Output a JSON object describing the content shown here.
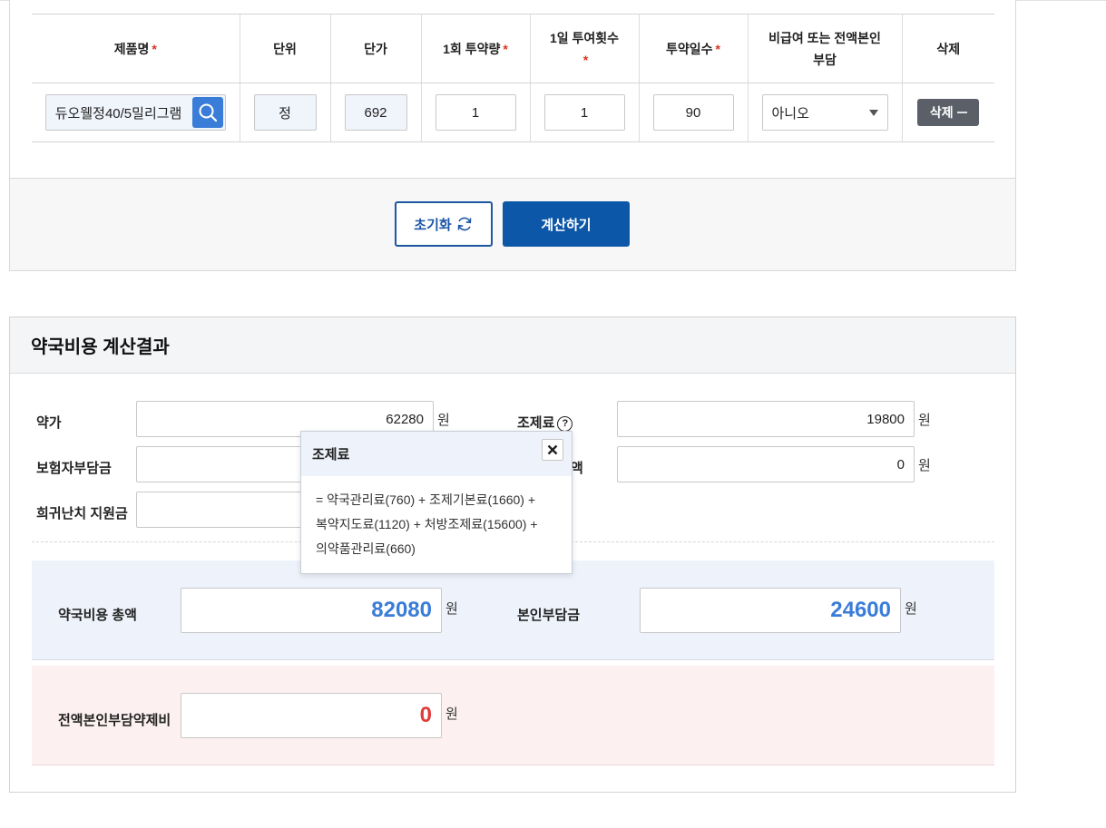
{
  "table": {
    "headers": {
      "product": "제품명",
      "unit": "단위",
      "price": "단가",
      "dose": "1회 투약량",
      "freq_line1": "1일 투여횟수",
      "days": "투약일수",
      "nonbenefit_line1": "비급여 또는 전액본인",
      "nonbenefit_line2": "부담",
      "delete": "삭제",
      "required_mark": "*"
    },
    "row": {
      "product": "듀오웰정40/5밀리그램",
      "unit": "정",
      "price": "692",
      "dose": "1",
      "freq": "1",
      "days": "90",
      "nonbenefit": "아니오",
      "delete_label": "삭제"
    }
  },
  "buttons": {
    "reset": "초기화",
    "calculate": "계산하기"
  },
  "result": {
    "title": "약국비용 계산결과",
    "unit": "원",
    "drug_price_label": "약가",
    "drug_price_value": "62280",
    "dispensing_fee_label": "조제료",
    "dispensing_fee_value": "19800",
    "insurer_label": "보험자부담금",
    "insurer_value": "",
    "hidden_label_tail": "액",
    "hidden_value": "0",
    "rare_label": "희귀난치 지원금",
    "rare_value": "",
    "total_label": "약국비용 총액",
    "total_value": "82080",
    "copay_label": "본인부담금",
    "copay_value": "24600",
    "full_copay_label": "전액본인부담약제비",
    "full_copay_value": "0"
  },
  "tooltip": {
    "title": "조제료",
    "line1": "= 약국관리료(760) + 조제기본료(1660) +",
    "line2": "복약지도료(1120) + 처방조제료(15600) +",
    "line3": "의약품관리료(660)"
  },
  "colors": {
    "primary": "#0d57a8",
    "accent_blue": "#3a7dd8",
    "accent_red": "#e03c3c",
    "required": "#d9341e"
  }
}
